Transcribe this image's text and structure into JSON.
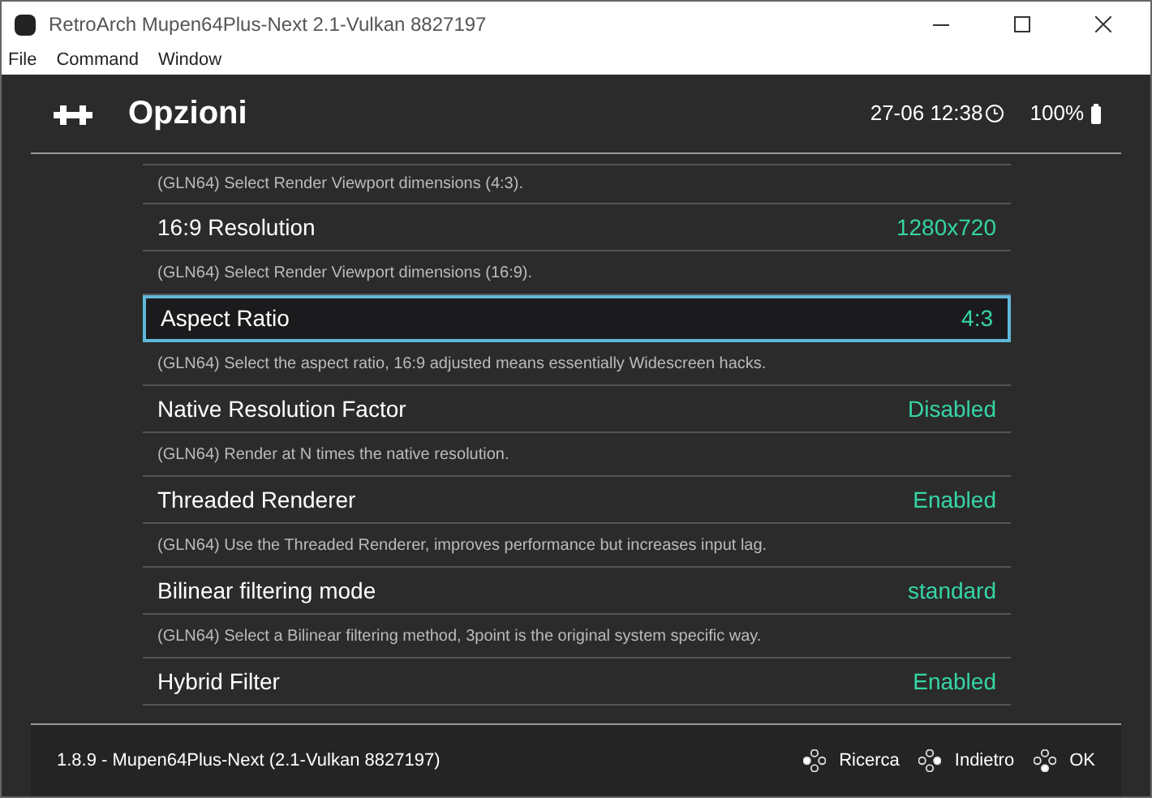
{
  "window": {
    "title": "RetroArch Mupen64Plus-Next 2.1-Vulkan 8827197"
  },
  "menu": [
    "File",
    "Command",
    "Window"
  ],
  "header": {
    "title": "Opzioni",
    "clock": "27-06 12:38",
    "battery": "100%"
  },
  "top_description": "(GLN64) Select Render Viewport dimensions (4:3).",
  "options": [
    {
      "label": "16:9 Resolution",
      "value": "1280x720",
      "selected": false,
      "description": "(GLN64) Select Render Viewport dimensions (16:9)."
    },
    {
      "label": "Aspect Ratio",
      "value": "4:3",
      "selected": true,
      "description": "(GLN64) Select the aspect ratio, 16:9 adjusted means essentially Widescreen hacks."
    },
    {
      "label": "Native Resolution Factor",
      "value": "Disabled",
      "selected": false,
      "description": "(GLN64) Render at N times the native resolution."
    },
    {
      "label": "Threaded Renderer",
      "value": "Enabled",
      "selected": false,
      "description": "(GLN64) Use the Threaded Renderer, improves performance but increases input lag."
    },
    {
      "label": "Bilinear filtering mode",
      "value": "standard",
      "selected": false,
      "description": "(GLN64) Select a Bilinear filtering method, 3point is the original system specific way."
    },
    {
      "label": "Hybrid Filter",
      "value": "Enabled",
      "selected": false
    }
  ],
  "footer": {
    "version": "1.8.9 - Mupen64Plus-Next (2.1-Vulkan 8827197)",
    "actions": [
      "Ricerca",
      "Indietro",
      "OK"
    ]
  }
}
